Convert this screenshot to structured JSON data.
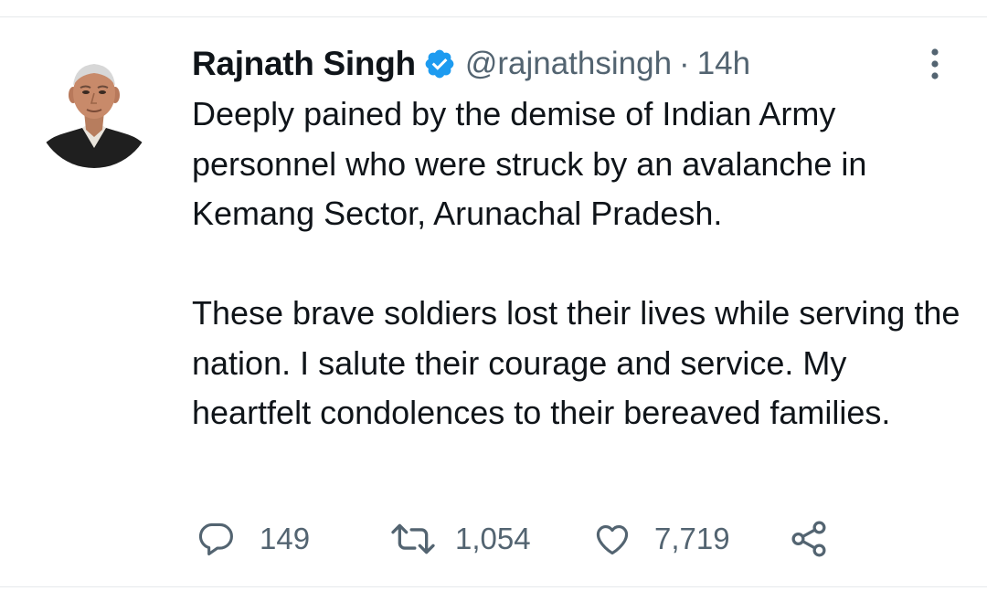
{
  "tweet": {
    "author_name": "Rajnath Singh",
    "handle": "@rajnathsingh",
    "separator": "·",
    "timestamp": "14h",
    "verified": true,
    "paragraphs": [
      "Deeply pained by the demise of Indian Army personnel who were struck by an avalanche in Kemang Sector, Arunachal Pradesh.",
      "These brave soldiers lost their lives while serving the nation. I salute their courage and service. My heartfelt condolences to their bereaved families."
    ]
  },
  "actions": {
    "replies": "149",
    "retweets": "1,054",
    "likes": "7,719"
  },
  "icons": {
    "verified": "verified-badge-icon",
    "more": "more-vertical-icon",
    "reply": "reply-icon",
    "retweet": "retweet-icon",
    "like": "heart-icon",
    "share": "share-icon"
  },
  "colors": {
    "verified": "#1d9bf0",
    "text": "#0f1419",
    "secondary": "#536471"
  }
}
